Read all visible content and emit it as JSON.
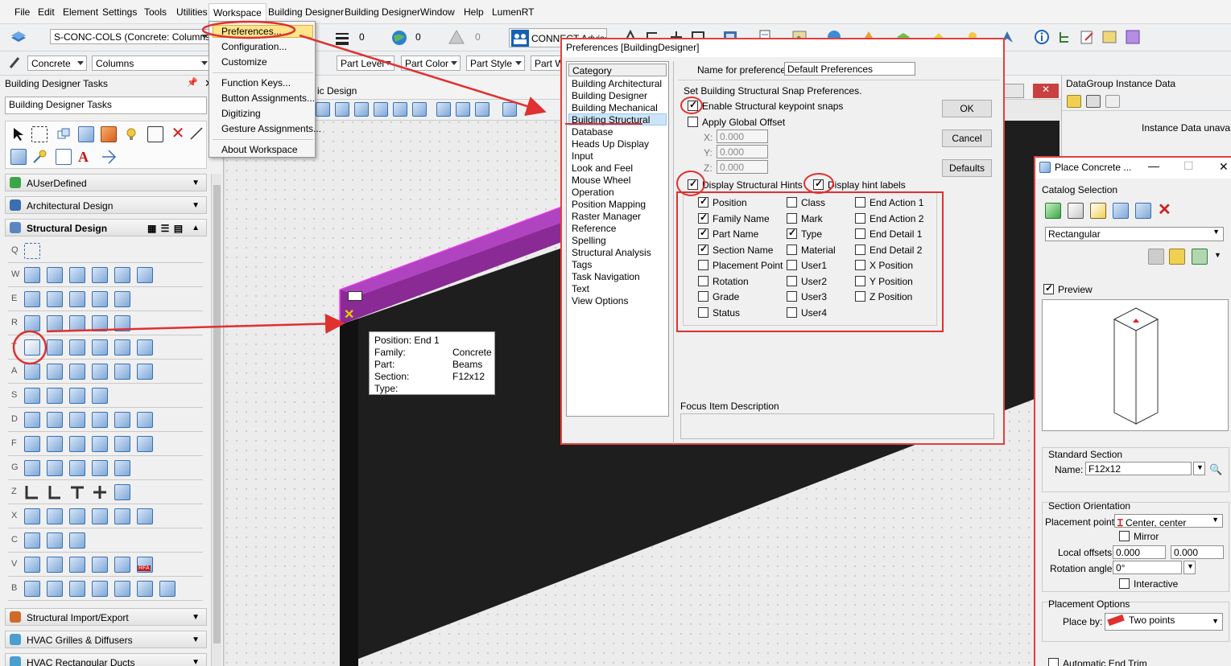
{
  "menubar": {
    "items": [
      "File",
      "Edit",
      "Element",
      "Settings",
      "Tools",
      "Utilities",
      "Workspace",
      "Building Designer",
      "Building Designer",
      "Window",
      "Help",
      "LumenRT"
    ]
  },
  "toolbar1": {
    "level_combo": "S-CONC-COLS (Concrete: Columns)",
    "weight_value": "0",
    "color_value": "0",
    "transparency_value": "0",
    "connect_label": "CONNECT Advisor"
  },
  "toolbar2": {
    "material_combo": "Concrete",
    "family_combo": "Columns",
    "part_level": "Part Level",
    "part_color": "Part Color",
    "part_style": "Part Style",
    "part_w": "Part W"
  },
  "workspace_menu": {
    "items": [
      "Preferences...",
      "Configuration...",
      "Customize",
      "Function Keys...",
      "Button Assignments...",
      "Digitizing",
      "Gesture Assignments...",
      "About Workspace"
    ]
  },
  "tasks": {
    "title": "Building Designer Tasks",
    "combo": "Building Designer Tasks",
    "categories": [
      "AUserDefined",
      "Architectural Design",
      "Structural Design",
      "Structural Import/Export",
      "HVAC Grilles & Diffusers",
      "HVAC Rectangular Ducts"
    ],
    "row_letters": [
      "Q",
      "W",
      "E",
      "R",
      "T",
      "A",
      "S",
      "D",
      "F",
      "G",
      "Z",
      "X",
      "C",
      "V",
      "B"
    ],
    "rfa_label": "RFA"
  },
  "viewport": {
    "title": "ic Design"
  },
  "tooltip": {
    "lines": [
      {
        "key": "Position:",
        "value": "End 1"
      },
      {
        "key": "Family:",
        "value": "Concrete"
      },
      {
        "key": "Part:",
        "value": "Beams"
      },
      {
        "key": "Section:",
        "value": "F12x12"
      },
      {
        "key": "Type:",
        "value": ""
      }
    ]
  },
  "preferences": {
    "title": "Preferences [BuildingDesigner]",
    "category_header": "Category",
    "categories": [
      "Building Architectural",
      "Building Designer",
      "Building Mechanical",
      "Building Structural",
      "Database",
      "Heads Up Display",
      "Input",
      "Look and Feel",
      "Mouse Wheel",
      "Operation",
      "Position Mapping",
      "Raster Manager",
      "Reference",
      "Spelling",
      "Structural Analysis",
      "Tags",
      "Task Navigation",
      "Text",
      "View Options"
    ],
    "selected_category": "Building Structural",
    "name_label": "Name for preferences",
    "name_value": "Default Preferences",
    "section_heading": "Set Building Structural Snap Preferences.",
    "enable_snaps": "Enable Structural keypoint snaps",
    "apply_offset": "Apply Global Offset",
    "x_label": "X:",
    "y_label": "Y:",
    "z_label": "Z:",
    "x_value": "0.000",
    "y_value": "0.000",
    "z_value": "0.000",
    "display_hints": "Display Structural Hints",
    "display_hint_labels": "Display hint labels",
    "hint_options": [
      {
        "label": "Position",
        "checked": true
      },
      {
        "label": "Family Name",
        "checked": true
      },
      {
        "label": "Part Name",
        "checked": true
      },
      {
        "label": "Section Name",
        "checked": true
      },
      {
        "label": "Placement Point",
        "checked": false
      },
      {
        "label": "Rotation",
        "checked": false
      },
      {
        "label": "Grade",
        "checked": false
      },
      {
        "label": "Status",
        "checked": false
      },
      {
        "label": "Class",
        "checked": false
      },
      {
        "label": "Mark",
        "checked": false
      },
      {
        "label": "Type",
        "checked": true
      },
      {
        "label": "Material",
        "checked": false
      },
      {
        "label": "User1",
        "checked": false
      },
      {
        "label": "User2",
        "checked": false
      },
      {
        "label": "User3",
        "checked": false
      },
      {
        "label": "User4",
        "checked": false
      },
      {
        "label": "End Action 1",
        "checked": false
      },
      {
        "label": "End Action 2",
        "checked": false
      },
      {
        "label": "End Detail 1",
        "checked": false
      },
      {
        "label": "End Detail 2",
        "checked": false
      },
      {
        "label": "X Position",
        "checked": false
      },
      {
        "label": "Y Position",
        "checked": false
      },
      {
        "label": "Z Position",
        "checked": false
      }
    ],
    "focus_label": "Focus Item Description",
    "ok": "OK",
    "cancel": "Cancel",
    "defaults": "Defaults"
  },
  "datagroup": {
    "title": "DataGroup Instance Data",
    "message": "Instance Data unavail"
  },
  "place_concrete": {
    "title": "Place Concrete ...",
    "catalog_label": "Catalog Selection",
    "catalog_value": "Rectangular",
    "preview_label": "Preview",
    "standard_section": "Standard Section",
    "name_label": "Name:",
    "name_value": "F12x12",
    "orientation_label": "Section Orientation",
    "placement_label": "Placement point:",
    "placement_value": "Center, center",
    "mirror_label": "Mirror",
    "offsets_label": "Local offsets:",
    "offset_x": "0.000",
    "offset_y": "0.000",
    "rotation_label": "Rotation angle:",
    "rotation_value": "0°",
    "interactive_label": "Interactive",
    "placement_options": "Placement Options",
    "place_by_label": "Place by:",
    "place_by_value": "Two points",
    "auto_trim": "Automatic End Trim"
  }
}
